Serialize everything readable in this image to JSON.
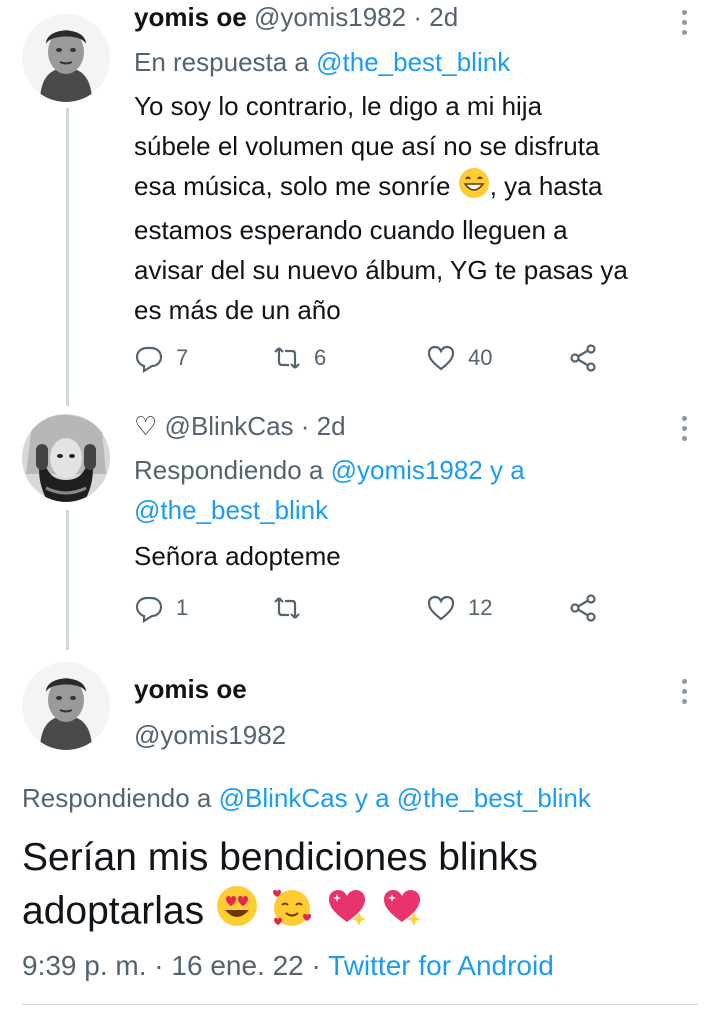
{
  "tweet1": {
    "name": "yomis oe",
    "handle": "@yomis1982",
    "time": "2d",
    "reply_prefix": "En respuesta a",
    "reply_to": "@the_best_blink",
    "lines": [
      "Yo soy lo contrario, le digo a mi hija",
      "súbele el volumen que así no se disfruta",
      "esa música, solo me sonríe",
      ", ya hasta",
      "estamos esperando cuando lleguen a",
      "avisar del su nuevo álbum, YG te pasas ya",
      "es más de un año"
    ],
    "replies": "7",
    "retweets": "6",
    "likes": "40"
  },
  "tweet2": {
    "heart_glyph": "♡",
    "handle": "@BlinkCas",
    "time": "2d",
    "reply_prefix": "Respondiendo a",
    "reply_to_1": "@yomis1982",
    "reply_joiner": "y a",
    "reply_to_2": "@the_best_blink",
    "text": "Señora adopteme",
    "replies": "1",
    "retweets": "",
    "likes": "12"
  },
  "main": {
    "name": "yomis oe",
    "handle": "@yomis1982",
    "reply_prefix": "Respondiendo a",
    "reply_to_1": "@BlinkCas",
    "reply_joiner": "y a",
    "reply_to_2": "@the_best_blink",
    "line1": "Serían mis bendiciones blinks",
    "line2": "adoptarlas",
    "time": "9:39 p. m.",
    "date": "16 ene. 22",
    "source": "Twitter for Android"
  },
  "separator": "·",
  "colors": {
    "link": "#1d9bf0",
    "muted": "#536471",
    "text": "#0f1419"
  }
}
